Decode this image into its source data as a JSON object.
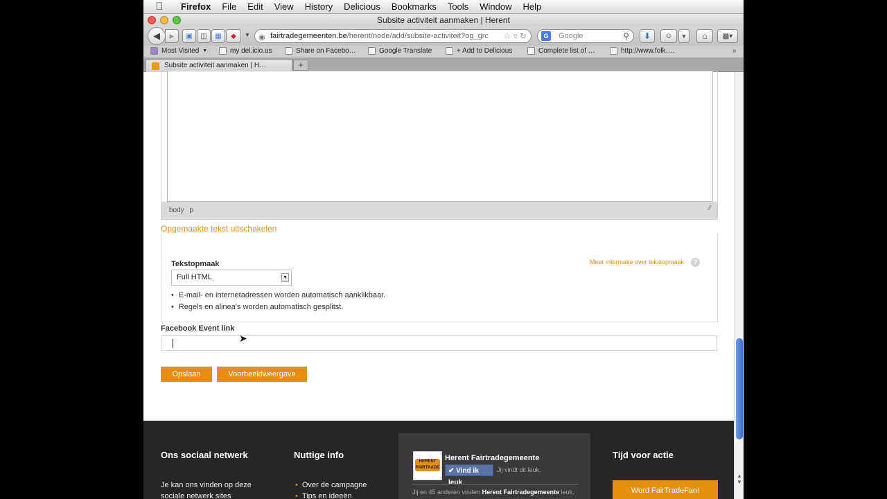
{
  "menubar": {
    "items": [
      "Firefox",
      "File",
      "Edit",
      "View",
      "History",
      "Delicious",
      "Bookmarks",
      "Tools",
      "Window",
      "Help"
    ]
  },
  "window": {
    "title": "Subsite activiteit aanmaken | Herent"
  },
  "toolbar": {
    "url_host": "fairtradegemeenten.be",
    "url_path": "/herent/node/add/subsite-activiteit?og_grc",
    "search_placeholder": "Google"
  },
  "bookmarks": [
    "Most Visited",
    "my del.icio.us",
    "Share on Facebo…",
    "Google Translate",
    "+ Add to Delicious",
    "Complete list of …",
    "http://www.folk…."
  ],
  "tab": {
    "label": "Subsite activiteit aanmaken | H…",
    "new_tab": "+"
  },
  "editor": {
    "path": [
      "body",
      "p"
    ]
  },
  "form": {
    "toggle_link": "Opgemaakte tekst uitschakelen",
    "format_label": "Tekstopmaak",
    "format_value": "Full HTML",
    "format_more": "Meer informatie over tekstopmaak",
    "tips": [
      "E-mail- en internetadressen worden automatisch aanklikbaar.",
      "Regels en alinea's worden automatisch gesplitst."
    ],
    "fb_label": "Facebook Event link",
    "save": "Opslaan",
    "preview": "Voorbeeldweergave"
  },
  "footer": {
    "col1_title": "Ons sociaal netwerk",
    "col1_text1": "Je kan ons vinden op deze",
    "col1_text2": "sociale netwerk sites",
    "col2_title": "Nuttige info",
    "col2_links": [
      "Over de campagne",
      "Tips en ideeën"
    ],
    "fb_page_name": "Herent Fairtradegemeente",
    "fb_like": "Vind ik leuk",
    "fb_you_like": "Jij vindt dit leuk.",
    "fb_count_pre": "Jij en 45 anderen vinden",
    "fb_count_name": "Herent Fairtradegemeente",
    "fb_count_post": "leuk.",
    "col4_title": "Tijd voor actie",
    "fan_button": "Word FairTradeFan!"
  },
  "colors": {
    "accent": "#e68f0e",
    "footer_bg": "#262626",
    "link": "#e28d13"
  }
}
